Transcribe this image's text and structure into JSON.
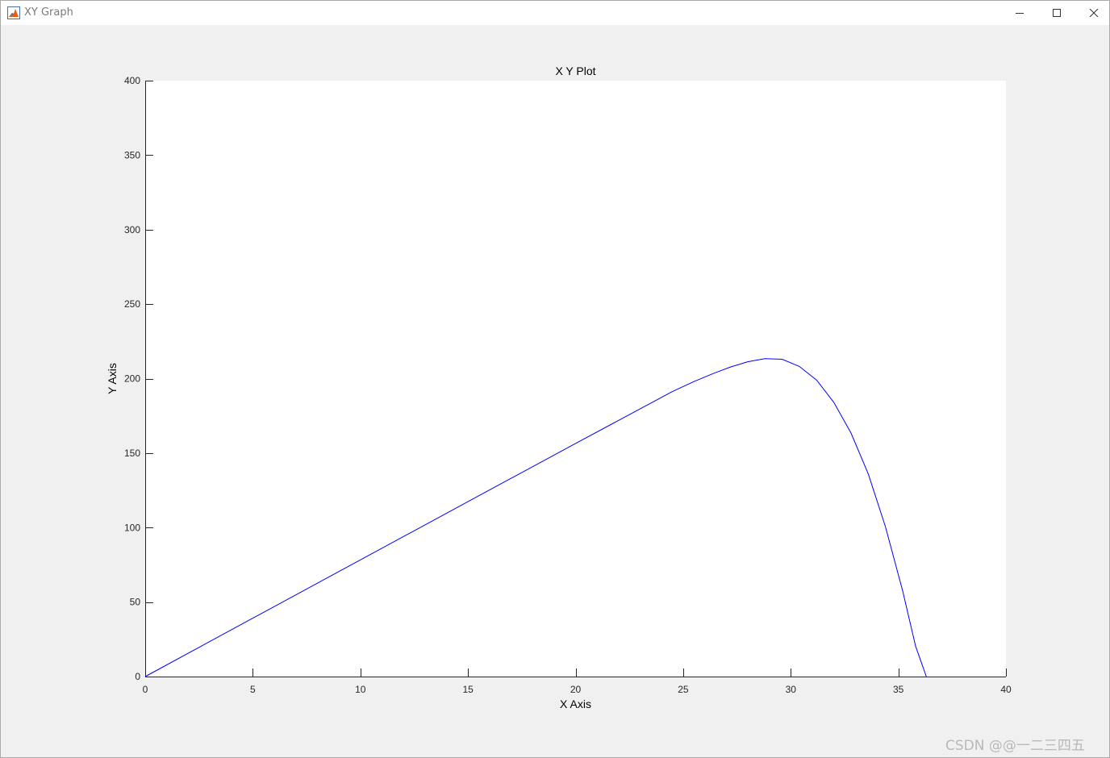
{
  "window": {
    "title": "XY Graph",
    "icon": "matlab-icon",
    "controls": [
      "minimize-icon",
      "maximize-icon",
      "close-icon"
    ]
  },
  "chart_data": {
    "type": "line",
    "title": "X Y Plot",
    "xlabel": "X Axis",
    "ylabel": "Y Axis",
    "xlim": [
      0,
      40
    ],
    "ylim": [
      0,
      400
    ],
    "xticks": [
      0,
      5,
      10,
      15,
      20,
      25,
      30,
      35,
      40
    ],
    "yticks": [
      0,
      50,
      100,
      150,
      200,
      250,
      300,
      350,
      400
    ],
    "grid": false,
    "line_color": "#0000ff",
    "series": [
      {
        "x": [
          0,
          5,
          10,
          15,
          20,
          24.5,
          25.5,
          26.4,
          27.2,
          28.0,
          28.8,
          29.6,
          30.4,
          31.2,
          32.0,
          32.8,
          33.6,
          34.4,
          35.2,
          35.8,
          36.3
        ],
        "y": [
          0,
          39.2,
          78.3,
          117.4,
          156.5,
          191.3,
          198.0,
          203.4,
          207.8,
          211.3,
          213.4,
          213.0,
          208.2,
          199.0,
          184.1,
          163.5,
          136.1,
          100.6,
          57.5,
          20.4,
          0
        ]
      }
    ]
  },
  "watermark": "CSDN @@一二三四五"
}
